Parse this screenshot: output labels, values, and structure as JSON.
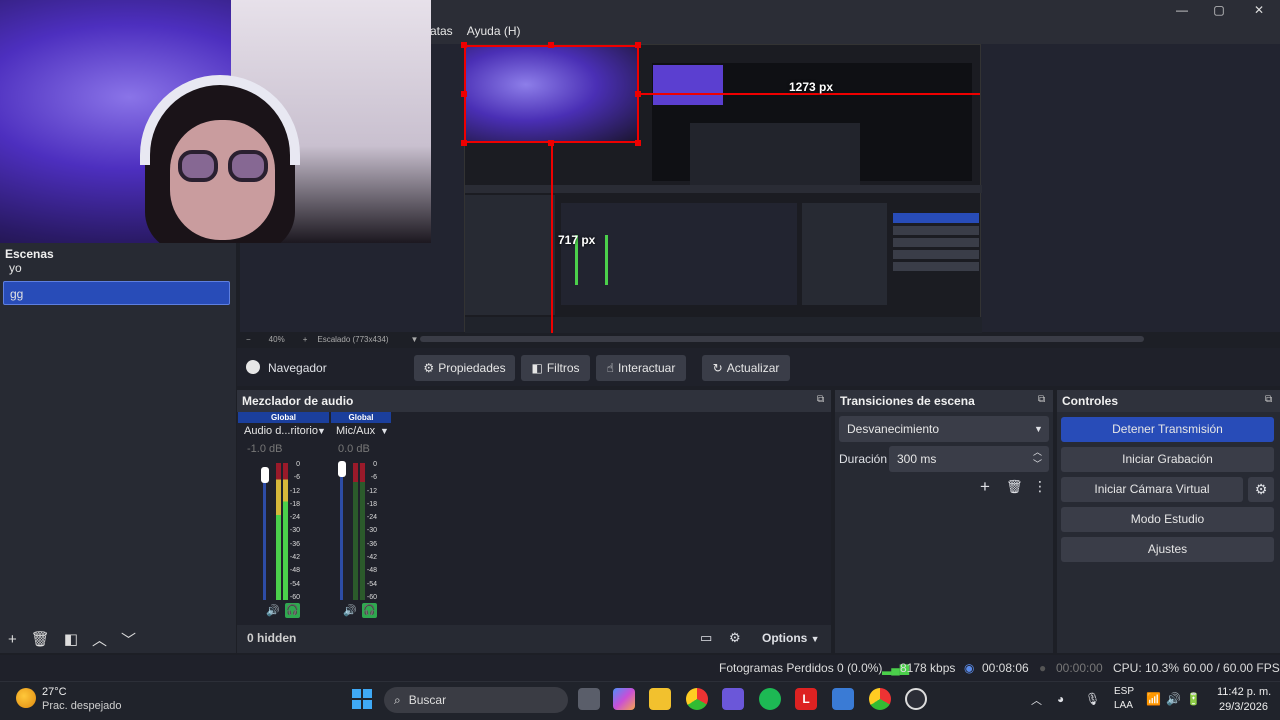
{
  "menu": {
    "items": [
      "atas",
      "Ayuda (H)"
    ]
  },
  "window": {
    "minimize": "—",
    "maximize": "▢",
    "close": "✕"
  },
  "preview": {
    "measure_h": "1273 px",
    "measure_v": "717 px",
    "zoom": "40%",
    "scale_mode": "Escalado (773x434)",
    "zoom_minus": "−",
    "zoom_plus": "+"
  },
  "scenes": {
    "title": "Escenas",
    "items": [
      {
        "label": "yo"
      },
      {
        "label": "gg"
      }
    ],
    "selected": "gg"
  },
  "source_toolbar": {
    "source_name": "Navegador",
    "properties": "Propiedades",
    "filters": "Filtros",
    "interact": "Interactuar",
    "refresh": "Actualizar"
  },
  "audio_mixer": {
    "title": "Mezclador de audio",
    "channels": [
      {
        "header": "Global",
        "name": "Audio d...ritorio",
        "db": "-1.0 dB"
      },
      {
        "header": "Global",
        "name": "Mic/Aux",
        "db": "0.0 dB"
      }
    ],
    "scale": [
      "0",
      "-6",
      "-12",
      "-18",
      "-24",
      "-30",
      "-36",
      "-42",
      "-48",
      "-54",
      "-60"
    ],
    "hidden": "0 hidden",
    "options": "Options"
  },
  "transitions": {
    "title": "Transiciones de escena",
    "selected": "Desvanecimiento",
    "duration_label": "Duración",
    "duration_value": "300 ms"
  },
  "controls": {
    "title": "Controles",
    "stop_stream": "Detener Transmisión",
    "start_recording": "Iniciar Grabación",
    "start_virtual_cam": "Iniciar Cámara Virtual",
    "studio_mode": "Modo Estudio",
    "settings": "Ajustes"
  },
  "status": {
    "dropped": "Fotogramas Perdidos 0 (0.0%)",
    "bitrate": "8178 kbps",
    "stream_time": "00:08:06",
    "rec_time": "00:00:00",
    "cpu": "CPU: 10.3%",
    "fps": "60.00 / 60.00 FPS"
  },
  "taskbar": {
    "weather_temp": "27°C",
    "weather_desc": "Prac. despejado",
    "search": "Buscar",
    "lang1": "ESP",
    "lang2": "LAA",
    "time": "11:42 p. m.",
    "date": "29/3/2026"
  },
  "colors": {
    "accent": "#284cb8",
    "meter_green": "#4bd04b",
    "meter_yellow": "#d6b83a",
    "meter_red": "#9a1a2a",
    "recording_red": "#e00000"
  }
}
